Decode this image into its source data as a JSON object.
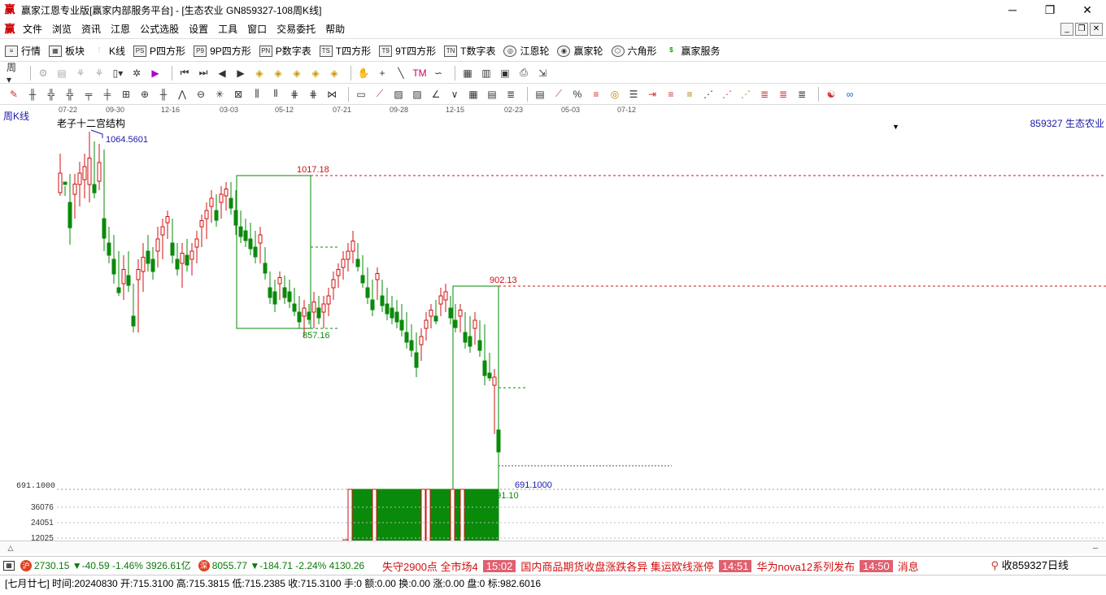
{
  "window": {
    "title": "赢家江恩专业版[赢家内部服务平台] - [生态农业  GN859327-108周K线]",
    "app_logo": "赢",
    "minimize": "─",
    "maximize": "❐",
    "close": "✕"
  },
  "menu": {
    "logo": "赢",
    "items": [
      "文件",
      "浏览",
      "资讯",
      "江恩",
      "公式选股",
      "设置",
      "工具",
      "窗口",
      "交易委托",
      "帮助"
    ]
  },
  "toolbar1": {
    "items": [
      {
        "label": "行情",
        "icon": "list-icon"
      },
      {
        "label": "板块",
        "icon": "grid-icon"
      },
      {
        "label": "K线",
        "icon": "candle-icon"
      },
      {
        "label": "P四方形",
        "icon": "PS"
      },
      {
        "label": "9P四方形",
        "icon": "P9"
      },
      {
        "label": "P数字表",
        "icon": "PN"
      },
      {
        "label": "T四方形",
        "icon": "TS"
      },
      {
        "label": "9T四方形",
        "icon": "T9"
      },
      {
        "label": "T数字表",
        "icon": "TN"
      },
      {
        "label": "江恩轮",
        "icon": "wheel-icon"
      },
      {
        "label": "赢家轮",
        "icon": "wheel2-icon"
      },
      {
        "label": "六角形",
        "icon": "hex-icon"
      },
      {
        "label": "赢家服务",
        "icon": "dollar-icon"
      }
    ]
  },
  "chart": {
    "period_label": "周K线",
    "indicator_name": "老子十二宫结构",
    "code_name": "859327 生态农业",
    "x_ticks": [
      "07-22",
      "09-30",
      "12-16",
      "03-03",
      "05-12",
      "07-21",
      "09-28",
      "12-15",
      "02-23",
      "05-03",
      "07-12"
    ],
    "labels": {
      "high": "1064.5601",
      "box1_top": "1017.18",
      "box1_bottom": "857.16",
      "box2_top": "902.13",
      "current": "691.1000",
      "axis_price": "691.1000",
      "box2_bottom": "691.10"
    },
    "volume_ticks": [
      "36076",
      "24051",
      "12025"
    ],
    "colors": {
      "up": "#d01010",
      "down": "#0a8a0a",
      "line": "#1a1aa8"
    }
  },
  "chart_data": {
    "type": "candlestick",
    "title": "老子十二宫结构",
    "series_name": "859327 生态农业",
    "key_levels": [
      1064.5601,
      1017.18,
      902.13,
      857.16,
      691.1
    ],
    "last_close": 691.1,
    "volume_ticks": [
      36076,
      24051,
      12025
    ]
  },
  "scrollbar": {
    "left": "△",
    "right": "─"
  },
  "status": {
    "sh_icon": "沪",
    "sh_quote": "2730.15 ▼-40.59 -1.46% 3926.61亿",
    "sz_icon": "深",
    "sz_quote": "8055.77 ▼-184.71 -2.24% 4130.26",
    "news": [
      {
        "text": "失守2900点 全市场4",
        "time": ""
      },
      {
        "text": "国内商品期货收盘涨跌各异 集运欧线涨停",
        "time": "15:02"
      },
      {
        "text": "华为nova12系列发布",
        "time": "14:51"
      },
      {
        "text": "消息",
        "time": "14:50"
      }
    ],
    "right_text": "收859327日线"
  },
  "infobar": {
    "text": "[七月廿七] 时间:20240830 开:715.3100 高:715.3815 低:715.2385 收:715.3100 手:0 额:0.00 换:0.00 涨:0.00 盘:0 标:982.6016"
  }
}
